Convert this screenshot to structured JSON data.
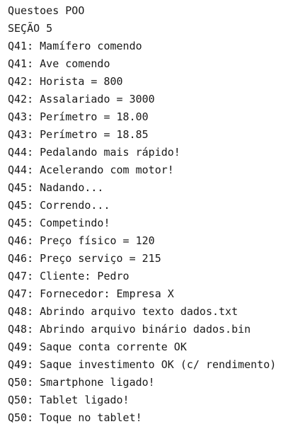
{
  "console": {
    "lines": [
      "Questoes POO",
      "SEÇÃO 5",
      "Q41: Mamífero comendo",
      "Q41: Ave comendo",
      "Q42: Horista = 800",
      "Q42: Assalariado = 3000",
      "Q43: Perímetro = 18.00",
      "Q43: Perímetro = 18.85",
      "Q44: Pedalando mais rápido!",
      "Q44: Acelerando com motor!",
      "Q45: Nadando...",
      "Q45: Correndo...",
      "Q45: Competindo!",
      "Q46: Preço físico = 120",
      "Q46: Preço serviço = 215",
      "Q47: Cliente: Pedro",
      "Q47: Fornecedor: Empresa X",
      "Q48: Abrindo arquivo texto dados.txt",
      "Q48: Abrindo arquivo binário dados.bin",
      "Q49: Saque conta corrente OK",
      "Q49: Saque investimento OK (c/ rendimento)",
      "Q50: Smartphone ligado!",
      "Q50: Tablet ligado!",
      "Q50: Toque no tablet!"
    ]
  }
}
